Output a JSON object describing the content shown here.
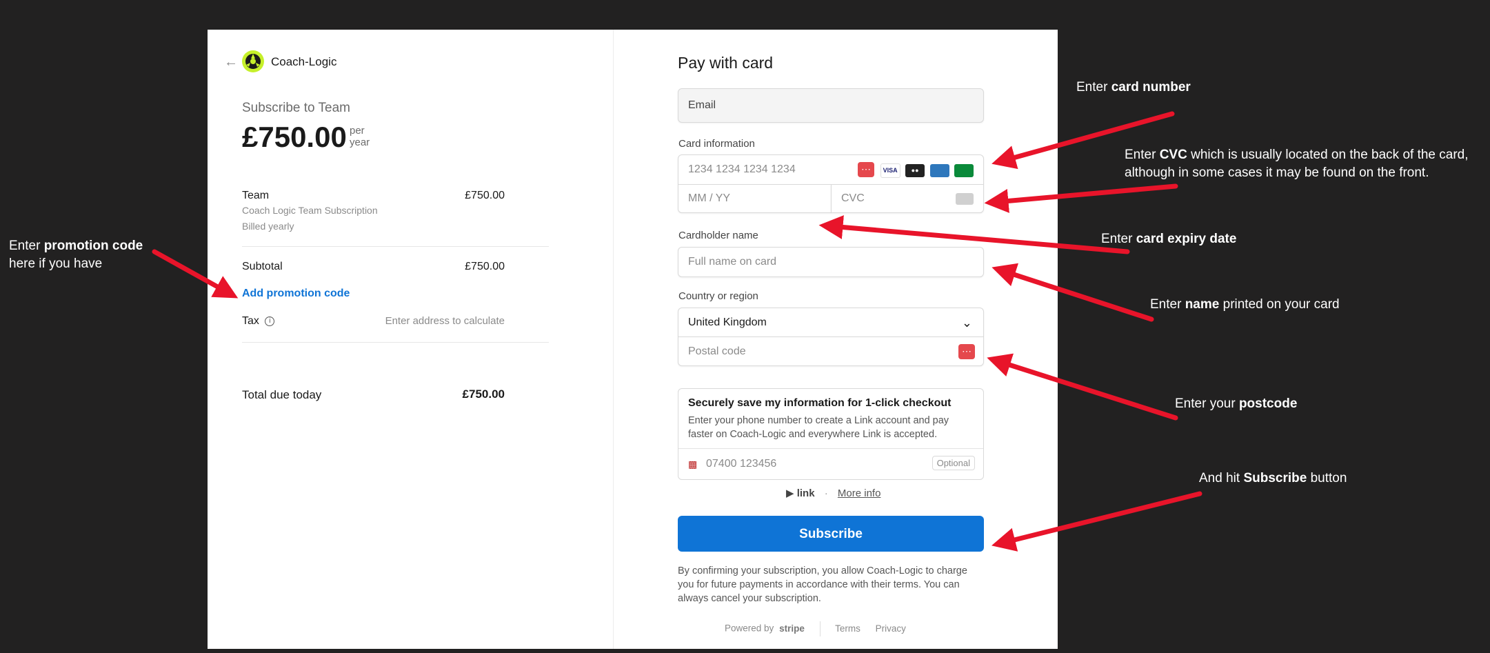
{
  "merchant": {
    "back_icon": "arrow-left-icon",
    "logo_icon": "coach-logic-logo",
    "name": "Coach-Logic"
  },
  "summary": {
    "subscribe_to": "Subscribe to Team",
    "price": "£750.00",
    "per_line1": "per",
    "per_line2": "year",
    "item": {
      "name": "Team",
      "description": "Coach Logic Team Subscription",
      "billing": "Billed yearly",
      "amount": "£750.00"
    },
    "subtotal_label": "Subtotal",
    "subtotal_value": "£750.00",
    "promo_link": "Add promotion code",
    "tax_label": "Tax",
    "tax_info_icon": "info-circle-icon",
    "tax_value": "Enter address to calculate",
    "total_label": "Total due today",
    "total_value": "£750.00"
  },
  "payment": {
    "title": "Pay with card",
    "email_placeholder": "Email",
    "card_info_label": "Card information",
    "card_number_placeholder": "1234 1234 1234 1234",
    "card_brands": [
      "VISA",
      "Mastercard",
      "AMEX",
      "JCB"
    ],
    "expiry_placeholder": "MM / YY",
    "cvc_placeholder": "CVC",
    "cardholder_label": "Cardholder name",
    "cardholder_placeholder": "Full name on card",
    "country_label": "Country or region",
    "country_value": "United Kingdom",
    "postal_placeholder": "Postal code",
    "save_title": "Securely save my information for 1-click checkout",
    "save_desc": "Enter your phone number to create a Link account and pay faster on Coach-Logic and everywhere Link is accepted.",
    "phone_placeholder": "07400 123456",
    "optional_badge": "Optional",
    "link_brand": "link",
    "more_info": "More info",
    "subscribe_button": "Subscribe",
    "legal": "By confirming your subscription, you allow Coach-Logic to charge you for future payments in accordance with their terms. You can always cancel your subscription.",
    "powered_by": "Powered by",
    "stripe": "stripe",
    "terms": "Terms",
    "privacy": "Privacy"
  },
  "annotations": {
    "promo_pre": "Enter ",
    "promo_bold": "promotion code",
    "promo_post": "here if you have",
    "card_pre": "Enter ",
    "card_bold": "card number",
    "cvc_pre": "Enter ",
    "cvc_bold": "CVC",
    "cvc_post": " which is usually located on the back of the card,",
    "cvc_line2": "although in some cases it may be found on the front.",
    "expiry_pre": "Enter ",
    "expiry_bold": "card expiry date",
    "name_pre": "Enter ",
    "name_bold": "name",
    "name_post": " printed on your card",
    "post_pre": "Enter your ",
    "post_bold": "postcode",
    "sub_pre": "And hit ",
    "sub_bold": "Subscribe",
    "sub_post": " button",
    "arrow_color": "#e8142a"
  }
}
